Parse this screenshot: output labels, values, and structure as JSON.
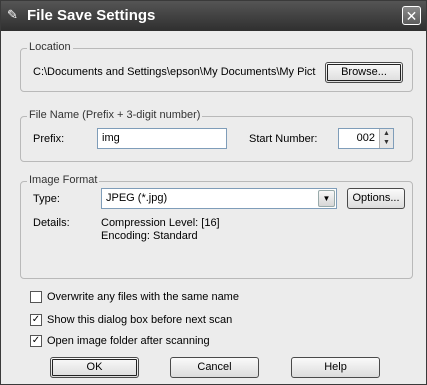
{
  "window": {
    "title": "File Save Settings",
    "close_label": "✕"
  },
  "location": {
    "label": "Location",
    "path": "C:\\Documents and Settings\\epson\\My Documents\\My Pict",
    "browse_label": "Browse..."
  },
  "filename": {
    "label": "File Name (Prefix + 3-digit number)",
    "prefix_label": "Prefix:",
    "prefix_value": "img",
    "start_label": "Start Number:",
    "start_value": "002"
  },
  "format": {
    "label": "Image Format",
    "type_label": "Type:",
    "type_value": "JPEG (*.jpg)",
    "options_label": "Options...",
    "details_label": "Details:",
    "compression": "Compression Level: [16]",
    "encoding": "Encoding: Standard"
  },
  "checks": [
    {
      "label": "Overwrite any files with the same name",
      "checked": false
    },
    {
      "label": "Show this dialog box before next scan",
      "checked": true
    },
    {
      "label": "Open image folder after scanning",
      "checked": true
    }
  ],
  "buttons": {
    "ok": "OK",
    "cancel": "Cancel",
    "help": "Help"
  }
}
